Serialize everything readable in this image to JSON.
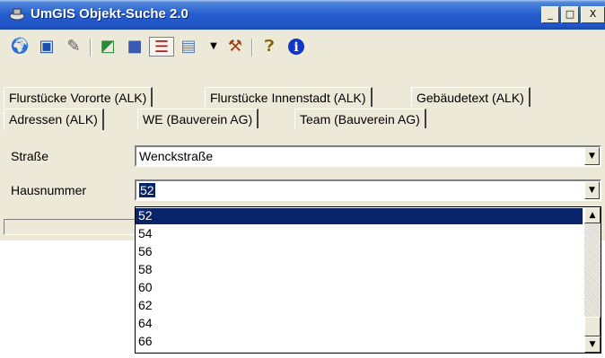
{
  "window": {
    "title": "UmGIS Objekt-Suche 2.0",
    "controls": {
      "minimize": "_",
      "maximize": "□",
      "close": "X"
    }
  },
  "toolbar": {
    "icons": [
      "globe-icon",
      "map-view-icon",
      "edit-icon",
      "layers-icon",
      "marker-icon",
      "list-icon",
      "panel-icon",
      "dropdown-arrow-icon",
      "tools-icon",
      "help-icon",
      "info-icon"
    ]
  },
  "tabs": {
    "row1": [
      "Flurstücke Vororte (ALK)",
      "Flurstücke Innenstadt (ALK)",
      "Gebäudetext (ALK)"
    ],
    "row2": [
      "Adressen (ALK)",
      "WE (Bauverein AG)",
      "Team  (Bauverein AG)"
    ],
    "active": "Adressen (ALK)"
  },
  "form": {
    "strasse_label": "Straße",
    "strasse_value": "Wenckstraße",
    "hausnummer_label": "Hausnummer",
    "hausnummer_value": "52"
  },
  "dropdown": {
    "items": [
      "52",
      "54",
      "56",
      "58",
      "60",
      "62",
      "64",
      "66"
    ],
    "selected": "52"
  },
  "colors": {
    "title_bar": "#245ccf",
    "selection": "#0a246a",
    "face": "#ece9d8"
  }
}
